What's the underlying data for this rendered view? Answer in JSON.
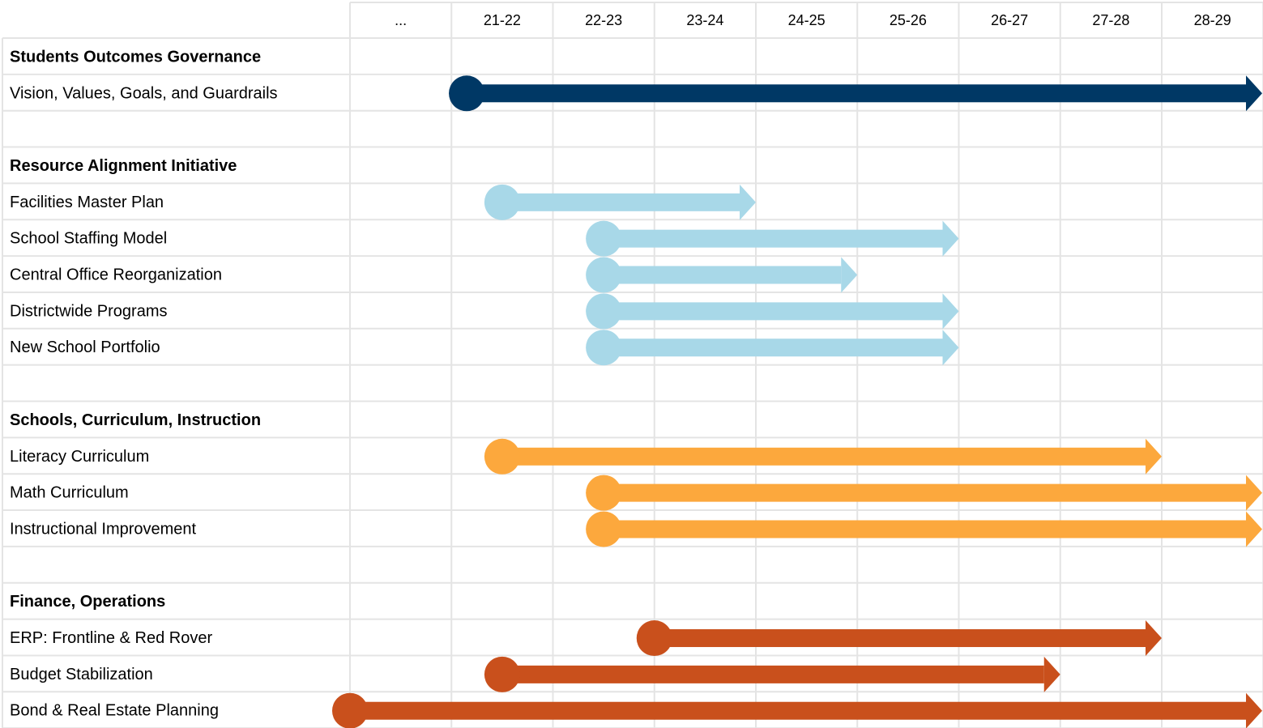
{
  "chart_data": {
    "type": "gantt",
    "columns": [
      "...",
      "21-22",
      "22-23",
      "23-24",
      "24-25",
      "25-26",
      "26-27",
      "27-28",
      "28-29"
    ],
    "colors": {
      "governance": "#003865",
      "resource": "#a8d8e8",
      "schools": "#fca83d",
      "finance": "#c9501c",
      "grid": "#e4e4e4"
    },
    "rows": [
      {
        "label": "Students Outcomes Governance",
        "header": true
      },
      {
        "label": "Vision, Values, Goals, and Guardrails",
        "start": 1.15,
        "end": 9,
        "color": "governance"
      },
      {
        "label": "",
        "spacer": true
      },
      {
        "label": "Resource Alignment Initiative",
        "header": true
      },
      {
        "label": "Facilities Master Plan",
        "start": 1.5,
        "end": 4,
        "color": "resource"
      },
      {
        "label": "School Staffing Model",
        "start": 2.5,
        "end": 6,
        "color": "resource"
      },
      {
        "label": "Central Office Reorganization",
        "start": 2.5,
        "end": 5,
        "color": "resource"
      },
      {
        "label": "Districtwide Programs",
        "start": 2.5,
        "end": 6,
        "color": "resource"
      },
      {
        "label": "New School Portfolio",
        "start": 2.5,
        "end": 6,
        "color": "resource"
      },
      {
        "label": "",
        "spacer": true
      },
      {
        "label": "Schools, Curriculum, Instruction",
        "header": true
      },
      {
        "label": "Literacy Curriculum",
        "start": 1.5,
        "end": 8,
        "color": "schools"
      },
      {
        "label": "Math Curriculum",
        "start": 2.5,
        "end": 9,
        "color": "schools"
      },
      {
        "label": "Instructional Improvement",
        "start": 2.5,
        "end": 9,
        "color": "schools"
      },
      {
        "label": "",
        "spacer": true
      },
      {
        "label": "Finance, Operations",
        "header": true
      },
      {
        "label": "ERP: Frontline & Red Rover",
        "start": 3,
        "end": 8,
        "color": "finance"
      },
      {
        "label": "Budget Stabilization",
        "start": 1.5,
        "end": 7,
        "color": "finance"
      },
      {
        "label": "Bond & Real Estate Planning",
        "start": 0,
        "end": 9,
        "color": "finance"
      }
    ]
  }
}
